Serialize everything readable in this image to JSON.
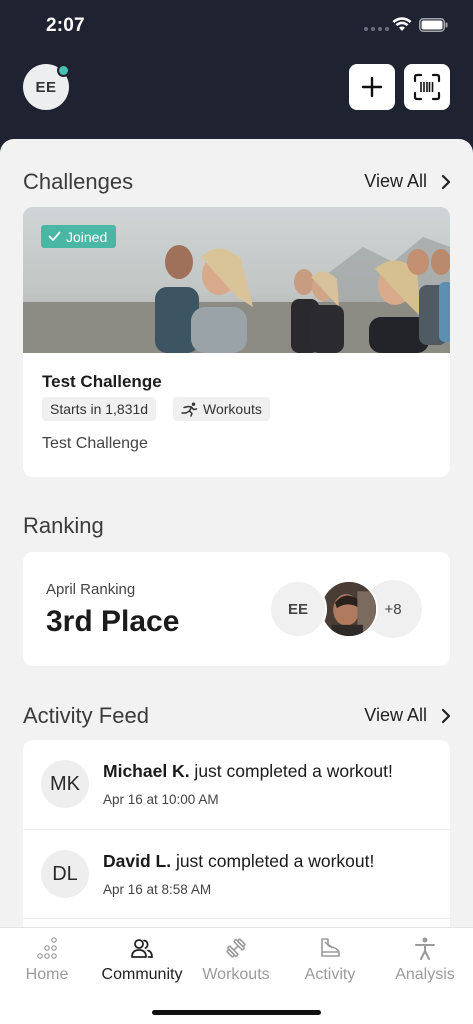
{
  "status_bar": {
    "time": "2:07"
  },
  "header": {
    "user_initials": "EE",
    "icons": {
      "add": "plus-icon",
      "scan": "barcode-scan-icon"
    }
  },
  "challenges": {
    "title": "Challenges",
    "view_all": "View All",
    "card": {
      "badge": "Joined",
      "name": "Test Challenge",
      "starts": "Starts in 1,831d",
      "type": "Workouts",
      "description": "Test Challenge"
    }
  },
  "ranking": {
    "title": "Ranking",
    "label": "April Ranking",
    "place": "3rd Place",
    "avatars": {
      "first": "EE",
      "more": "+8"
    }
  },
  "activity_feed": {
    "title": "Activity Feed",
    "view_all": "View All",
    "items": [
      {
        "initials": "MK",
        "name": "Michael K.",
        "action": " just completed a workout!",
        "time": "Apr 16 at 10:00 AM"
      },
      {
        "initials": "DL",
        "name": "David L.",
        "action": " just completed a workout!",
        "time": "Apr 16 at 8:58 AM"
      }
    ]
  },
  "tabs": [
    {
      "label": "Home",
      "icon": "dots-grid-icon",
      "active": false
    },
    {
      "label": "Community",
      "icon": "people-icon",
      "active": true
    },
    {
      "label": "Workouts",
      "icon": "dumbbell-icon",
      "active": false
    },
    {
      "label": "Activity",
      "icon": "activity-shoe-icon",
      "active": false
    },
    {
      "label": "Analysis",
      "icon": "person-icon",
      "active": false
    }
  ],
  "colors": {
    "accent": "#49b7a4",
    "header_bg": "#1f2230",
    "sheet_bg": "#f2f2f2"
  }
}
